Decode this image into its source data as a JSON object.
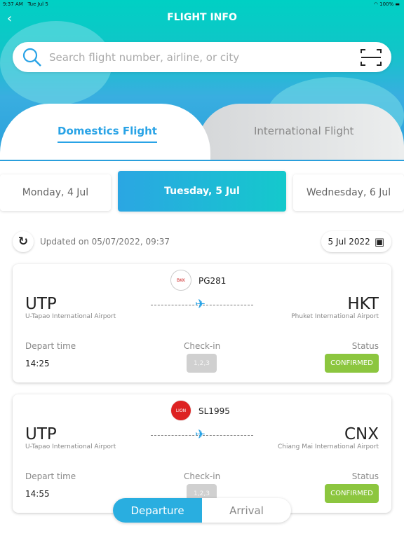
{
  "status_bar": {
    "time": "9:37 AM",
    "date": "Tue Jul 5",
    "battery": "100%"
  },
  "header": {
    "title": "FLIGHT INFO",
    "back_icon": "chevron-left"
  },
  "search": {
    "placeholder": "Search flight number, airline, or city"
  },
  "tabs": [
    {
      "label": "Domestics Flight",
      "active": true
    },
    {
      "label": "International Flight",
      "active": false
    }
  ],
  "dates": [
    {
      "label": "Monday, 4 Jul"
    },
    {
      "label": "Tuesday, 5 Jul",
      "active": true
    },
    {
      "label": "Wednesday, 6 Jul"
    }
  ],
  "updated": {
    "text": "Updated on 05/07/2022, 09:37",
    "date_picker": "5 Jul 2022"
  },
  "labels": {
    "depart": "Depart time",
    "checkin": "Check-in",
    "status": "Status"
  },
  "flights": [
    {
      "airline_logo": "Bangkok Airways",
      "flight_no": "PG281",
      "from_code": "UTP",
      "from_name": "U-Tapao International Airport",
      "to_code": "HKT",
      "to_name": "Phuket International Airport",
      "depart": "14:25",
      "checkin": "1,2,3",
      "status": "CONFIRMED"
    },
    {
      "airline_logo": "Thai Lion Air",
      "flight_no": "SL1995",
      "from_code": "UTP",
      "from_name": "U-Tapao International Airport",
      "to_code": "CNX",
      "to_name": "Chiang Mai International Airport",
      "depart": "14:55",
      "checkin": "1,2,3",
      "status": "CONFIRMED"
    }
  ],
  "toggle": {
    "departure": "Departure",
    "arrival": "Arrival"
  },
  "colors": {
    "accent": "#29aee0",
    "teal": "#00d0c4",
    "confirmed": "#8cc63f"
  }
}
